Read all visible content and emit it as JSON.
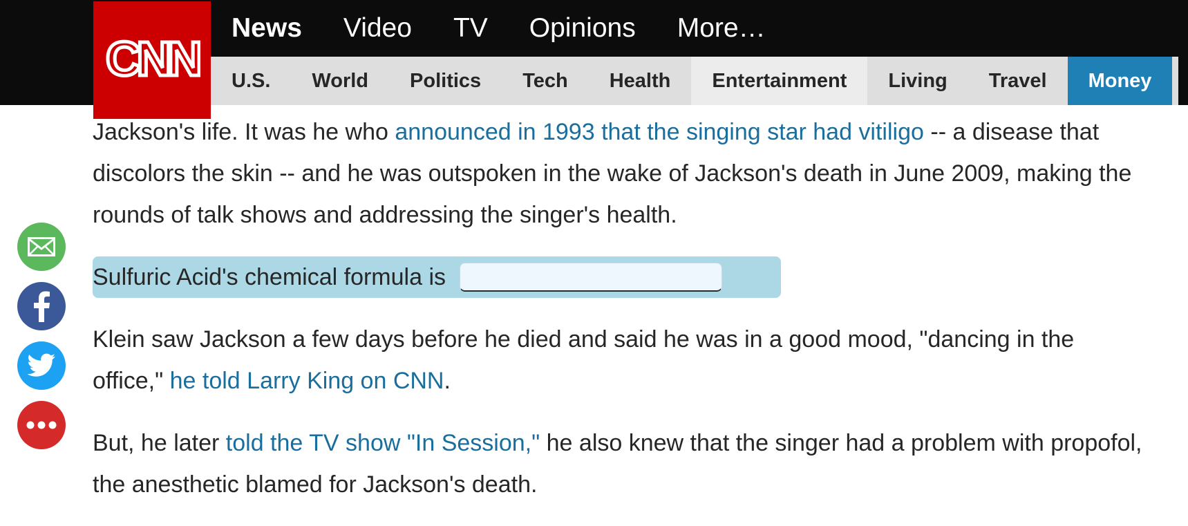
{
  "brand": {
    "logo_text": "CNN",
    "color": "#cc0000"
  },
  "main_nav": [
    {
      "label": "News",
      "active": true
    },
    {
      "label": "Video"
    },
    {
      "label": "TV"
    },
    {
      "label": "Opinions"
    },
    {
      "label": "More…"
    }
  ],
  "sub_nav": [
    {
      "label": "U.S."
    },
    {
      "label": "World"
    },
    {
      "label": "Politics"
    },
    {
      "label": "Tech"
    },
    {
      "label": "Health"
    },
    {
      "label": "Entertainment",
      "selected": true
    },
    {
      "label": "Living"
    },
    {
      "label": "Travel"
    },
    {
      "label": "Money",
      "accent": "#1e80b5"
    }
  ],
  "share": [
    {
      "name": "email",
      "icon": "envelope-icon",
      "color": "#5cb85c"
    },
    {
      "name": "facebook",
      "icon": "facebook-icon",
      "color": "#3b5998"
    },
    {
      "name": "twitter",
      "icon": "twitter-icon",
      "color": "#1da1f2"
    },
    {
      "name": "more",
      "icon": "more-dots-icon",
      "color": "#d42a2a"
    }
  ],
  "article": {
    "p1": {
      "before": "Jackson's life. It was he who ",
      "link": "announced in 1993 that the singing star had vitiligo",
      "after": " -- a disease that discolors the skin -- and he was outspoken in the wake of Jackson's death in June 2009, making the rounds of talk shows and addressing the singer's health."
    },
    "quiz": {
      "label": "Sulfuric Acid's chemical formula is",
      "value": ""
    },
    "p3": {
      "before": "Klein saw Jackson a few days before he died and said he was in a good mood, \"dancing in the office,\" ",
      "link": "he told Larry King on CNN",
      "after": "."
    },
    "p4": {
      "before": "But, he later ",
      "link": "told the TV show \"In Session,\"",
      "after": " he also knew that the singer had a problem with propofol, the anesthetic blamed for Jackson's death."
    }
  }
}
